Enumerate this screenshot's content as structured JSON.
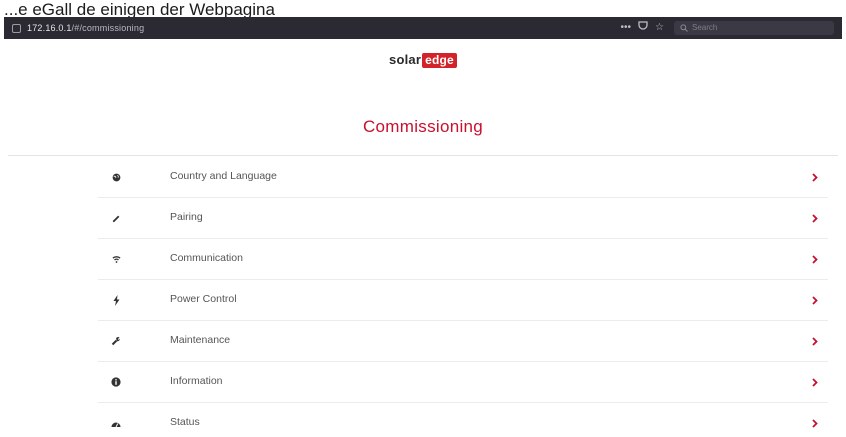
{
  "caption": "...e eGall de einigen der Webpagina",
  "browser": {
    "url_host": "172.16.0.1",
    "url_path": "/#/commissioning",
    "search_placeholder": "Search",
    "toolbar_icons": [
      "more-icon",
      "pocket-icon",
      "bookmark-icon"
    ]
  },
  "logo": {
    "text1": "solar",
    "text2": "edge"
  },
  "page": {
    "title": "Commissioning"
  },
  "menu": {
    "items": [
      {
        "label": "Country and Language",
        "icon": "globe-icon"
      },
      {
        "label": "Pairing",
        "icon": "pencil-icon"
      },
      {
        "label": "Communication",
        "icon": "wifi-icon"
      },
      {
        "label": "Power Control",
        "icon": "lightning-icon"
      },
      {
        "label": "Maintenance",
        "icon": "wrench-icon"
      },
      {
        "label": "Information",
        "icon": "info-icon"
      },
      {
        "label": "Status",
        "icon": "dashboard-icon"
      }
    ]
  },
  "colors": {
    "accent": "#c8102e",
    "icon": "#333333"
  }
}
